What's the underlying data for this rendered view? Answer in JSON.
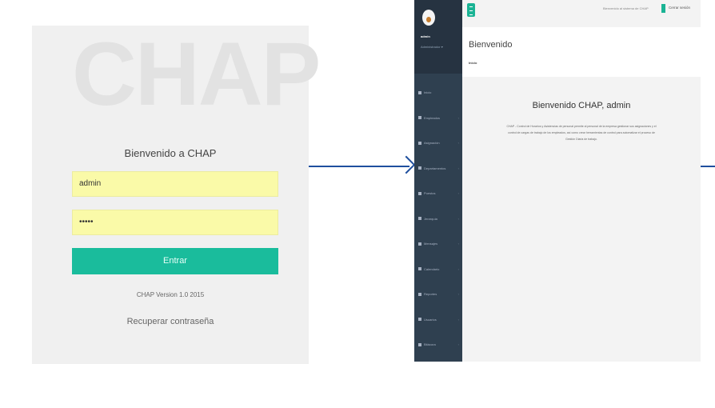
{
  "login": {
    "watermark": "CHAP",
    "welcome": "Bienvenido a CHAP",
    "username_value": "admin",
    "password_value": "•••••",
    "submit_label": "Entrar",
    "version": "CHAP Version 1.0 2015",
    "recover_link": "Recuperar contraseña"
  },
  "dashboard": {
    "profile": {
      "name": "admin",
      "role": "Administrador ▾"
    },
    "topbar": {
      "welcome_text": "Bienvenido al sistema de CHAP",
      "logout_label": "Cerrar sesión"
    },
    "nav_items": [
      {
        "label": "Inicio",
        "icon": "home-icon"
      },
      {
        "label": "Empleados",
        "icon": "user-icon"
      },
      {
        "label": "Asignación",
        "icon": "task-icon"
      },
      {
        "label": "Departamentos",
        "icon": "building-icon"
      },
      {
        "label": "Puestos",
        "icon": "briefcase-icon"
      },
      {
        "label": "Jerarquía",
        "icon": "sitemap-icon"
      },
      {
        "label": "Mensajes",
        "icon": "mail-icon"
      },
      {
        "label": "Calendario",
        "icon": "calendar-icon"
      },
      {
        "label": "Reportes",
        "icon": "chart-icon"
      },
      {
        "label": "Usuarios",
        "icon": "users-icon"
      },
      {
        "label": "Bitácora",
        "icon": "book-icon"
      }
    ],
    "heading": {
      "title": "Bienvenido",
      "breadcrumb": "Inicio"
    },
    "content": {
      "title": "Bienvenido CHAP, admin",
      "description": "CHAP - Control de Horarios y Asistencias de personal permite al personal de la empresa gestionar sus asignaciones y el control de cargas de trabajo de los empleados, así como crear herramientas de control para automatizar el proceso de Gestión Diaria de trabajo."
    }
  },
  "colors": {
    "accent": "#1ab394",
    "sidebar": "#2f4050",
    "input_bg": "#fafaa8",
    "arrow": "#1f4f9e"
  }
}
